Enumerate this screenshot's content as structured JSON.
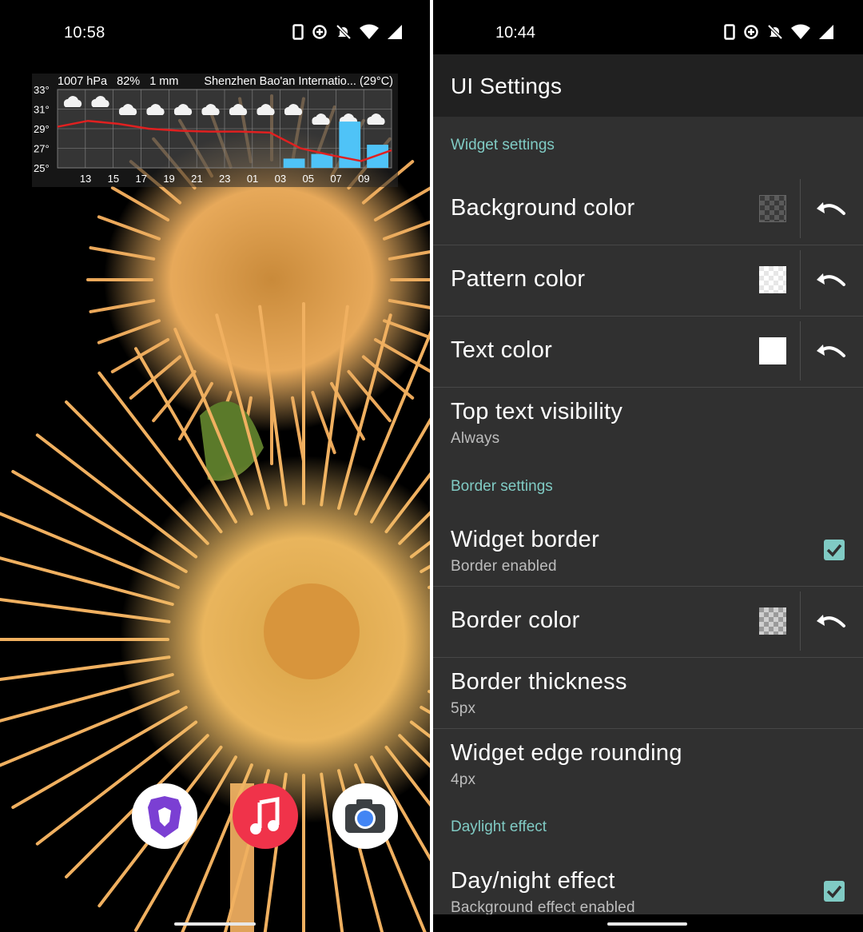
{
  "left": {
    "status": {
      "time": "10:58",
      "icons": [
        "phone-icon",
        "data-saver-icon",
        "bell-off-icon",
        "wifi-icon",
        "signal-icon"
      ]
    },
    "widget": {
      "pressure": "1007 hPa",
      "humidity": "82%",
      "precip": "1 mm",
      "location": "Shenzhen Bao'an Internatio... (29°C)",
      "y_ticks": [
        "33°",
        "31°",
        "29°",
        "27°",
        "25°"
      ],
      "x_ticks": [
        "13",
        "15",
        "17",
        "19",
        "21",
        "23",
        "01",
        "03",
        "05",
        "07",
        "09"
      ],
      "colors": {
        "temp_line": "#e02020",
        "precip_bar": "#4fc3f7"
      }
    },
    "dock": {
      "apps": [
        "brave-browser-icon",
        "music-icon",
        "camera-icon"
      ]
    }
  },
  "right": {
    "status": {
      "time": "10:44",
      "icons": [
        "phone-icon",
        "data-saver-icon",
        "bell-off-icon",
        "wifi-icon",
        "signal-icon"
      ]
    },
    "title": "UI Settings",
    "accent": "#80cbc4",
    "sections": {
      "widget": "Widget settings",
      "border": "Border settings",
      "daylight": "Daylight effect"
    },
    "rows": {
      "bg_color": {
        "label": "Background color"
      },
      "pattern_color": {
        "label": "Pattern color"
      },
      "text_color": {
        "label": "Text color"
      },
      "top_text": {
        "label": "Top text visibility",
        "summary": "Always"
      },
      "widget_border": {
        "label": "Widget border",
        "summary": "Border enabled",
        "checked": true
      },
      "border_color": {
        "label": "Border color"
      },
      "border_thickness": {
        "label": "Border thickness",
        "summary": "5px"
      },
      "edge_rounding": {
        "label": "Widget edge rounding",
        "summary": "4px"
      },
      "day_night": {
        "label": "Day/night effect",
        "summary": "Background effect enabled",
        "checked": true
      }
    }
  },
  "chart_data": {
    "type": "line",
    "x": [
      "13",
      "15",
      "17",
      "19",
      "21",
      "23",
      "01",
      "03",
      "05",
      "07",
      "09"
    ],
    "series": [
      {
        "values": [
          29.2,
          29.8,
          29.5,
          29.0,
          28.8,
          28.7,
          28.7,
          28.6,
          27.0,
          26.3,
          25.7,
          26.8
        ]
      },
      {
        "values": [
          0,
          0,
          0,
          0,
          0,
          0,
          0,
          0,
          0.4,
          0.6,
          2.0,
          1.0
        ]
      }
    ],
    "ylim": [
      25,
      33
    ],
    "y_tick_labels": [
      "33°",
      "31°",
      "29°",
      "27°",
      "25°"
    ],
    "grid": true
  }
}
